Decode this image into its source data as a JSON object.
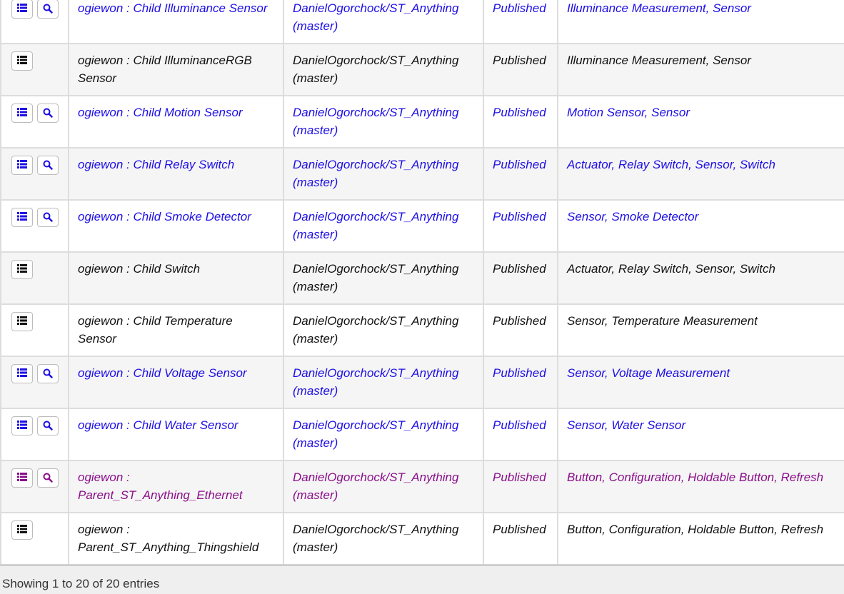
{
  "colors": {
    "link_unvisited": "#1d0ee6",
    "link_visited": "#8a0e8a",
    "plain": "#111111"
  },
  "rows": [
    {
      "name": "ogiewon : Child Illuminance Sensor",
      "repo": "DanielOgorchock/ST_Anything (master)",
      "status": "Published",
      "capabilities": "Illuminance Measurement, Sensor",
      "color": "blue",
      "has_search": true
    },
    {
      "name": "ogiewon : Child IlluminanceRGB Sensor",
      "repo": "DanielOgorchock/ST_Anything (master)",
      "status": "Published",
      "capabilities": "Illuminance Measurement, Sensor",
      "color": "black",
      "has_search": false
    },
    {
      "name": "ogiewon : Child Motion Sensor",
      "repo": "DanielOgorchock/ST_Anything (master)",
      "status": "Published",
      "capabilities": "Motion Sensor, Sensor",
      "color": "blue",
      "has_search": true
    },
    {
      "name": "ogiewon : Child Relay Switch",
      "repo": "DanielOgorchock/ST_Anything (master)",
      "status": "Published",
      "capabilities": "Actuator, Relay Switch, Sensor, Switch",
      "color": "blue",
      "has_search": true
    },
    {
      "name": "ogiewon : Child Smoke Detector",
      "repo": "DanielOgorchock/ST_Anything (master)",
      "status": "Published",
      "capabilities": "Sensor, Smoke Detector",
      "color": "blue",
      "has_search": true
    },
    {
      "name": "ogiewon : Child Switch",
      "repo": "DanielOgorchock/ST_Anything (master)",
      "status": "Published",
      "capabilities": "Actuator, Relay Switch, Sensor, Switch",
      "color": "black",
      "has_search": false
    },
    {
      "name": "ogiewon : Child Temperature Sensor",
      "repo": "DanielOgorchock/ST_Anything (master)",
      "status": "Published",
      "capabilities": "Sensor, Temperature Measurement",
      "color": "black",
      "has_search": false
    },
    {
      "name": "ogiewon : Child Voltage Sensor",
      "repo": "DanielOgorchock/ST_Anything (master)",
      "status": "Published",
      "capabilities": "Sensor, Voltage Measurement",
      "color": "blue",
      "has_search": true
    },
    {
      "name": "ogiewon : Child Water Sensor",
      "repo": "DanielOgorchock/ST_Anything (master)",
      "status": "Published",
      "capabilities": "Sensor, Water Sensor",
      "color": "blue",
      "has_search": true
    },
    {
      "name": "ogiewon : Parent_ST_Anything_Ethernet",
      "repo": "DanielOgorchock/ST_Anything (master)",
      "status": "Published",
      "capabilities": "Button, Configuration, Holdable Button, Refresh",
      "color": "purple",
      "has_search": true
    },
    {
      "name": "ogiewon : Parent_ST_Anything_Thingshield",
      "repo": "DanielOgorchock/ST_Anything (master)",
      "status": "Published",
      "capabilities": "Button, Configuration, Holdable Button, Refresh",
      "color": "black",
      "has_search": false
    }
  ],
  "footer": {
    "info": "Showing 1 to 20 of 20 entries"
  }
}
